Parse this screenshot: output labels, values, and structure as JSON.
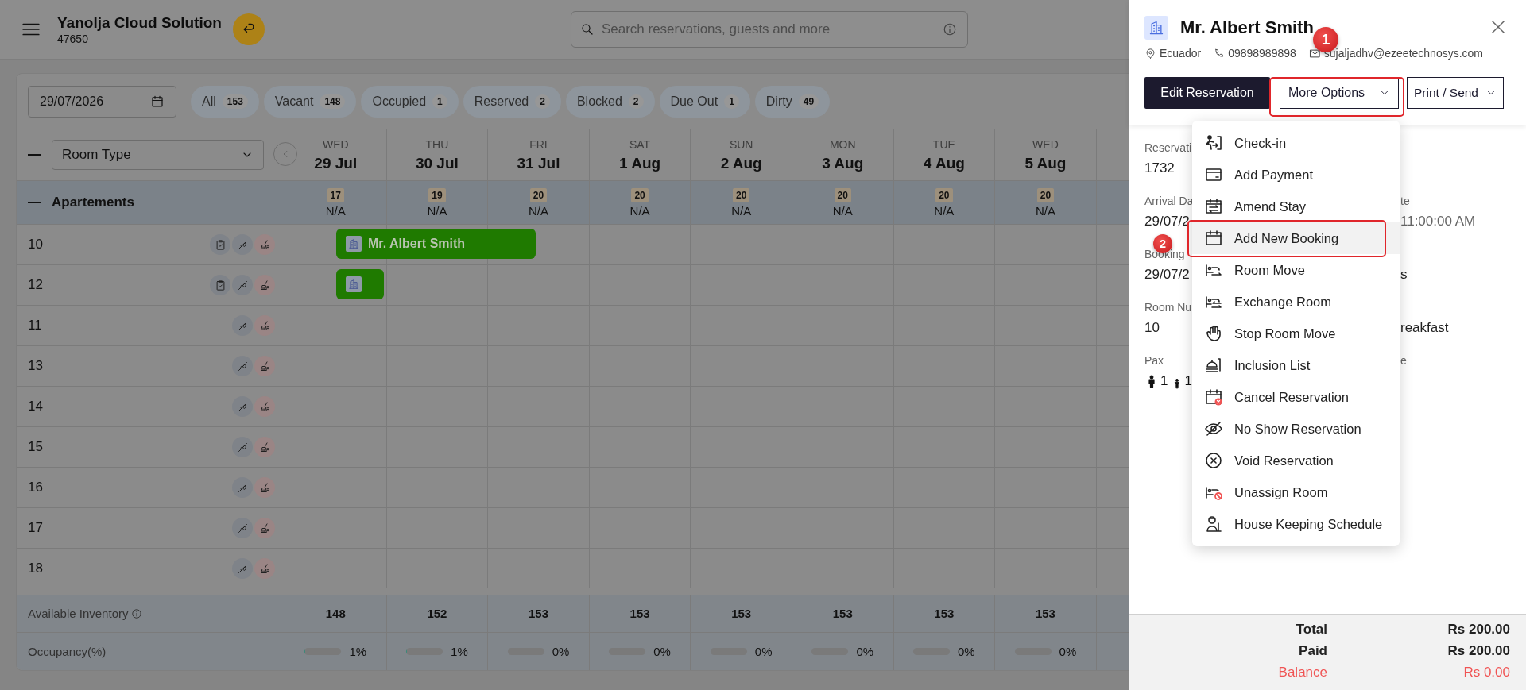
{
  "header": {
    "title": "Yanolja Cloud Solution",
    "subtitle": "47650",
    "search": {
      "placeholder": "Search reservations, guests and more"
    }
  },
  "toolbar": {
    "date": "29/07/2026",
    "filters": [
      {
        "label": "All",
        "count": "153"
      },
      {
        "label": "Vacant",
        "count": "148"
      },
      {
        "label": "Occupied",
        "count": "1"
      },
      {
        "label": "Reserved",
        "count": "2"
      },
      {
        "label": "Blocked",
        "count": "2"
      },
      {
        "label": "Due Out",
        "count": "1"
      },
      {
        "label": "Dirty",
        "count": "49"
      }
    ]
  },
  "grid": {
    "group_by": "Room Type",
    "days": [
      {
        "weekday": "WED",
        "date": "29 Jul",
        "available": "17",
        "rate": "N/A"
      },
      {
        "weekday": "THU",
        "date": "30 Jul",
        "available": "19",
        "rate": "N/A"
      },
      {
        "weekday": "FRI",
        "date": "31 Jul",
        "available": "20",
        "rate": "N/A"
      },
      {
        "weekday": "SAT",
        "date": "1 Aug",
        "available": "20",
        "rate": "N/A"
      },
      {
        "weekday": "SUN",
        "date": "2 Aug",
        "available": "20",
        "rate": "N/A"
      },
      {
        "weekday": "MON",
        "date": "3 Aug",
        "available": "20",
        "rate": "N/A"
      },
      {
        "weekday": "TUE",
        "date": "4 Aug",
        "available": "20",
        "rate": "N/A"
      },
      {
        "weekday": "WED",
        "date": "5 Aug",
        "available": "20",
        "rate": "N/A"
      }
    ],
    "section": {
      "name": "Apartements",
      "expanded": true
    },
    "rooms": [
      {
        "number": "10",
        "checklist": true,
        "booking": {
          "kind": "wide",
          "guest": "Mr. Albert Smith"
        }
      },
      {
        "number": "12",
        "checklist": true,
        "booking": {
          "kind": "narrow"
        }
      },
      {
        "number": "11",
        "checklist": false
      },
      {
        "number": "13",
        "checklist": false
      },
      {
        "number": "14",
        "checklist": false
      },
      {
        "number": "15",
        "checklist": false
      },
      {
        "number": "16",
        "checklist": false
      },
      {
        "number": "17",
        "checklist": false
      },
      {
        "number": "18",
        "checklist": false
      }
    ],
    "inventory": {
      "label": "Available Inventory",
      "values": [
        "148",
        "152",
        "153",
        "153",
        "153",
        "153",
        "153",
        "153"
      ]
    },
    "occupancy": {
      "label": "Occupancy(%)",
      "cells": [
        {
          "reading": "1%",
          "level": 0.01
        },
        {
          "reading": "1%",
          "level": 0.01
        },
        {
          "reading": "0%",
          "level": 0
        },
        {
          "reading": "0%",
          "level": 0
        },
        {
          "reading": "0%",
          "level": 0
        },
        {
          "reading": "0%",
          "level": 0
        },
        {
          "reading": "0%",
          "level": 0
        },
        {
          "reading": "0%",
          "level": 0
        }
      ]
    }
  },
  "panel": {
    "guest": "Mr. Albert Smith",
    "country": "Ecuador",
    "phone": "09898989898",
    "email": "sujaljadhv@ezeetechnosys.com",
    "buttons": [
      {
        "kind": "primary",
        "label": "Edit Reservation"
      },
      {
        "kind": "dropdown",
        "label": "More Options",
        "callout": "1"
      },
      {
        "kind": "dropdown",
        "label": "Print / Send"
      }
    ],
    "fields_left": [
      {
        "kind": "text",
        "label": "Reservati",
        "value": "1732"
      },
      {
        "kind": "text",
        "label": "Arrival Da",
        "value": "29/07/2"
      },
      {
        "kind": "text",
        "label": "Booking",
        "value": "29/07/2"
      },
      {
        "kind": "text",
        "label": "Room Nu",
        "value": "10"
      },
      {
        "kind": "pax",
        "label": "Pax",
        "adults": "1",
        "children": "1"
      }
    ],
    "fields_right": [
      {
        "label": "te",
        "value": "11:00:00 AM"
      },
      {
        "value": "s"
      },
      {
        "value": "reakfast"
      },
      {
        "label": "e"
      }
    ],
    "menu": [
      {
        "label": "Check-in",
        "highlighted": false
      },
      {
        "label": "Add Payment",
        "highlighted": false
      },
      {
        "label": "Amend Stay",
        "highlighted": false
      },
      {
        "label": "Add New Booking",
        "highlighted": true,
        "callout": "2"
      },
      {
        "label": "Room Move",
        "highlighted": false
      },
      {
        "label": "Exchange Room",
        "highlighted": false
      },
      {
        "label": "Stop Room Move",
        "highlighted": false
      },
      {
        "label": "Inclusion List",
        "highlighted": false
      },
      {
        "label": "Cancel Reservation",
        "highlighted": false
      },
      {
        "label": "No Show Reservation",
        "highlighted": false
      },
      {
        "label": "Void Reservation",
        "highlighted": false
      },
      {
        "label": "Unassign Room",
        "highlighted": false
      },
      {
        "label": "House Keeping Schedule",
        "highlighted": false
      }
    ],
    "totals": [
      {
        "kind": "normal",
        "label": "Total",
        "value": "Rs 200.00"
      },
      {
        "kind": "normal",
        "label": "Paid",
        "value": "Rs 200.00"
      },
      {
        "kind": "due",
        "label": "Balance",
        "value": "Rs 0.00"
      }
    ]
  }
}
